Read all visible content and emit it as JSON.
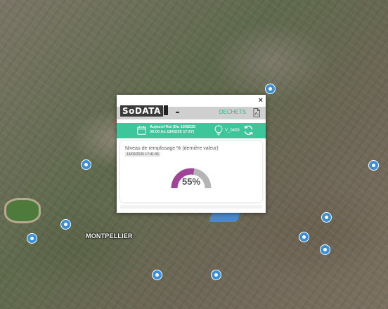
{
  "map": {
    "city_label": "MONTPELLIER"
  },
  "popup": {
    "close_glyph": "×",
    "logo_text": "SoDATA",
    "section_label": "DECHETS",
    "date_range_line1": "AujourdʼHui (Du 13/02/25",
    "date_range_line2": "00:00 Au 13/02/25 17:57)",
    "device_id": "V_0409",
    "card": {
      "title": "Niveau de remplissage % (dernière valeur)",
      "timestamp": "13/02/2025 17:41:36",
      "gauge_value": 55,
      "gauge_display": "55%"
    }
  },
  "colors": {
    "accent": "#3cc69a",
    "gauge_fill": "#a0449a",
    "gauge_track": "#b5b5b5",
    "marker": "#3b8fd6"
  },
  "icons": [
    "calendar-icon",
    "bulb-icon",
    "refresh-icon",
    "pdf-icon",
    "close-icon",
    "map-marker-icon"
  ]
}
